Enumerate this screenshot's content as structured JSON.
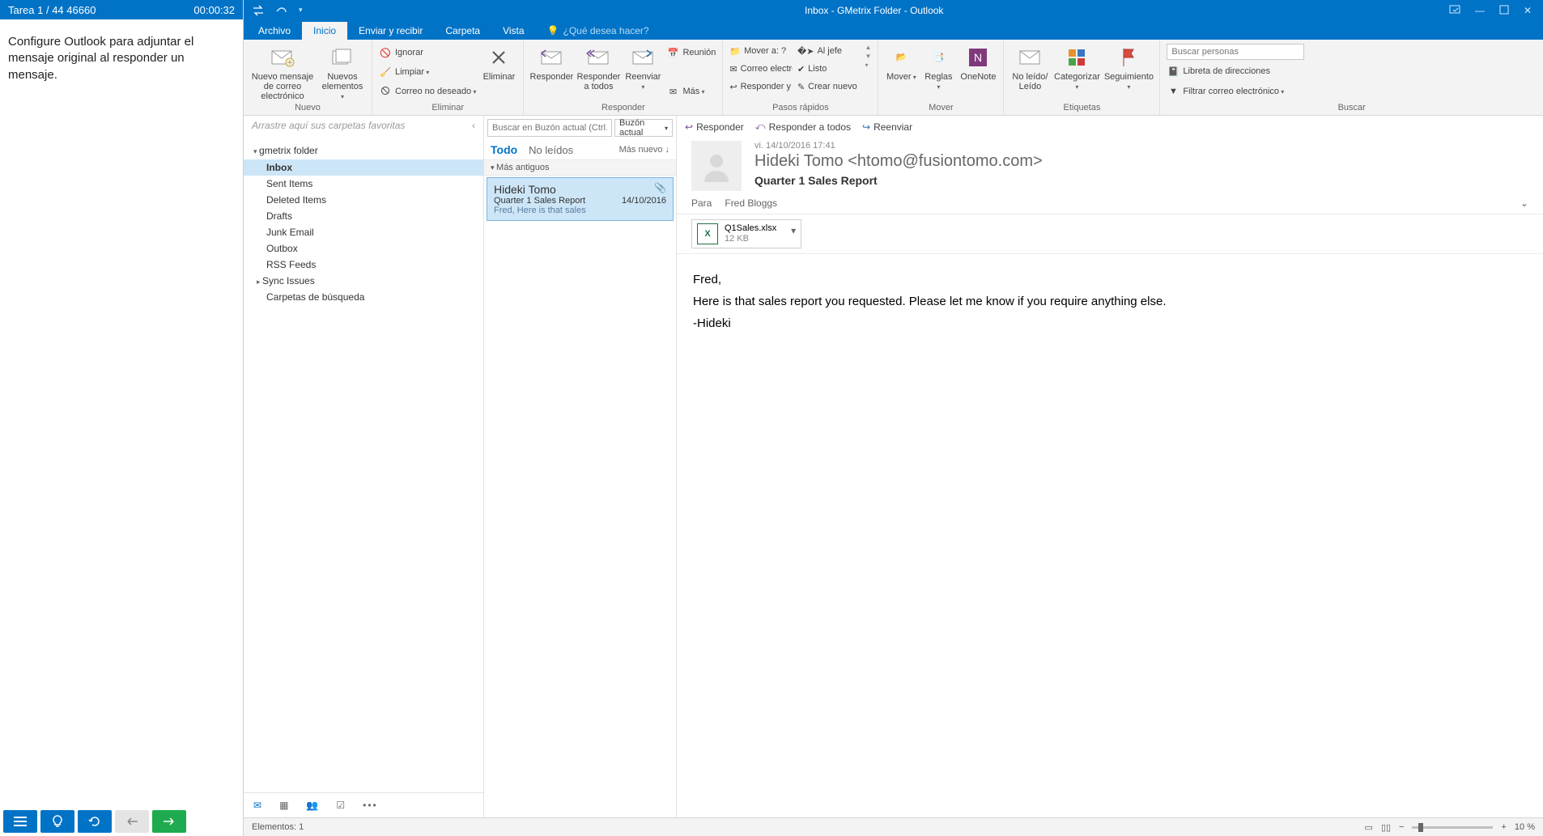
{
  "task": {
    "header_left": "Tarea 1 / 44 46660",
    "header_right": "00:00:32",
    "instruction": "Configure Outlook para adjuntar el mensaje original al responder un mensaje."
  },
  "titlebar": {
    "title": "Inbox - GMetrix Folder - Outlook"
  },
  "tabs": {
    "archivo": "Archivo",
    "inicio": "Inicio",
    "enviar": "Enviar y recibir",
    "carpeta": "Carpeta",
    "vista": "Vista",
    "tellme": "¿Qué desea hacer?"
  },
  "ribbon": {
    "nuevo": {
      "label": "Nuevo",
      "new_email": "Nuevo mensaje de correo electrónico",
      "new_items": "Nuevos elementos"
    },
    "eliminar": {
      "label": "Eliminar",
      "ignorar": "Ignorar",
      "limpiar": "Limpiar",
      "junk": "Correo no deseado",
      "eliminar_btn": "Eliminar"
    },
    "responder": {
      "label": "Responder",
      "responder": "Responder",
      "responder_todos": "Responder a todos",
      "reenviar": "Reenviar",
      "reunion": "Reunión",
      "mas": "Más"
    },
    "pasos": {
      "label": "Pasos rápidos",
      "mover_a": "Mover a: ?",
      "al_jefe": "Al jefe",
      "correo": "Correo electróni…",
      "listo": "Listo",
      "responder_eli": "Responder y eli…",
      "crear": "Crear nuevo"
    },
    "mover": {
      "label": "Mover",
      "mover": "Mover",
      "reglas": "Reglas",
      "onenote": "OneNote"
    },
    "etiquetas": {
      "label": "Etiquetas",
      "leido": "No leído/ Leído",
      "categorizar": "Categorizar",
      "seguimiento": "Seguimiento"
    },
    "buscar": {
      "label": "Buscar",
      "placeholder": "Buscar personas",
      "libreta": "Libreta de direcciones",
      "filtrar": "Filtrar correo electrónico"
    }
  },
  "folders": {
    "fav_hint": "Arrastre aquí sus carpetas favoritas",
    "root": "gmetrix folder",
    "items": [
      "Inbox",
      "Sent Items",
      "Deleted Items",
      "Drafts",
      "Junk Email",
      "Outbox",
      "RSS Feeds",
      "Sync Issues",
      "Carpetas de búsqueda"
    ]
  },
  "msglist": {
    "search_placeholder": "Buscar en Buzón actual (Ctrl…",
    "scope": "Buzón actual",
    "todo": "Todo",
    "no_leidos": "No leídos",
    "sort": "Más nuevo ↓",
    "group": "Más antiguos",
    "item": {
      "from": "Hideki Tomo",
      "subject": "Quarter 1 Sales Report",
      "preview": "Fred,  Here is that sales",
      "date": "14/10/2016"
    }
  },
  "reading": {
    "reply": "Responder",
    "reply_all": "Responder a todos",
    "forward": "Reenviar",
    "datetime": "vi. 14/10/2016 17:41",
    "sender": "Hideki Tomo <htomo@fusiontomo.com>",
    "subject": "Quarter 1 Sales Report",
    "to_label": "Para",
    "to_value": "Fred Bloggs",
    "attachment": {
      "name": "Q1Sales.xlsx",
      "size": "12 KB"
    },
    "body_line1": "Fred,",
    "body_line2": "Here is that sales report you requested. Please let me know if you require anything else.",
    "body_line3": "-Hideki"
  },
  "status": {
    "left": "Elementos: 1",
    "zoom": "10 %"
  }
}
